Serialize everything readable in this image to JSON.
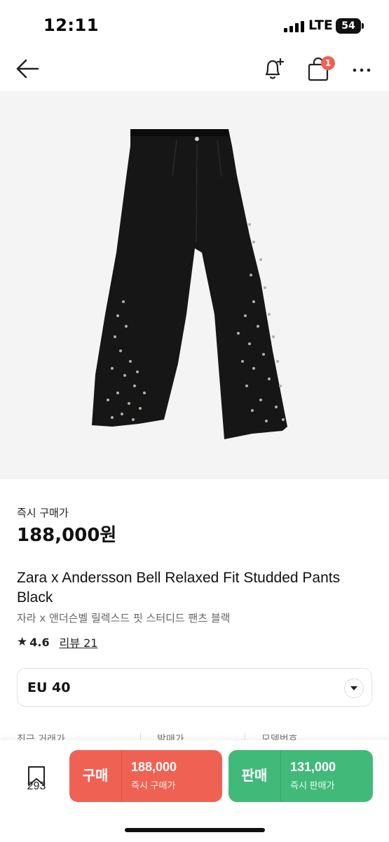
{
  "status_bar": {
    "time": "12:11",
    "network": "LTE",
    "battery": "54"
  },
  "nav": {
    "cart_badge": "1",
    "icons": [
      "arrow-left-icon",
      "bell-plus-icon",
      "shopping-bag-icon",
      "more-horizontal-icon"
    ]
  },
  "product": {
    "image_icon": "product-pants-image",
    "price_label": "즉시 구매가",
    "price": "188,000원",
    "title_en": "Zara x Andersson Bell Relaxed Fit Studded Pants Black",
    "title_ko": "자라 x 앤더슨벨 릴렉스드 핏 스터디드 팬츠 블랙",
    "rating": "4.6",
    "review_label": "리뷰 21"
  },
  "size_select": {
    "value": "EU 40"
  },
  "info_columns": [
    "최근 거래가",
    "발매가",
    "모델번호"
  ],
  "bottom_bar": {
    "wish_count": "293",
    "buy": {
      "label": "구매",
      "price": "188,000",
      "sub": "즉시 구매가"
    },
    "sell": {
      "label": "판매",
      "price": "131,000",
      "sub": "즉시 판매가"
    }
  },
  "colors": {
    "buy": "#ef6253",
    "sell": "#41b979",
    "badge": "#ef6253"
  }
}
